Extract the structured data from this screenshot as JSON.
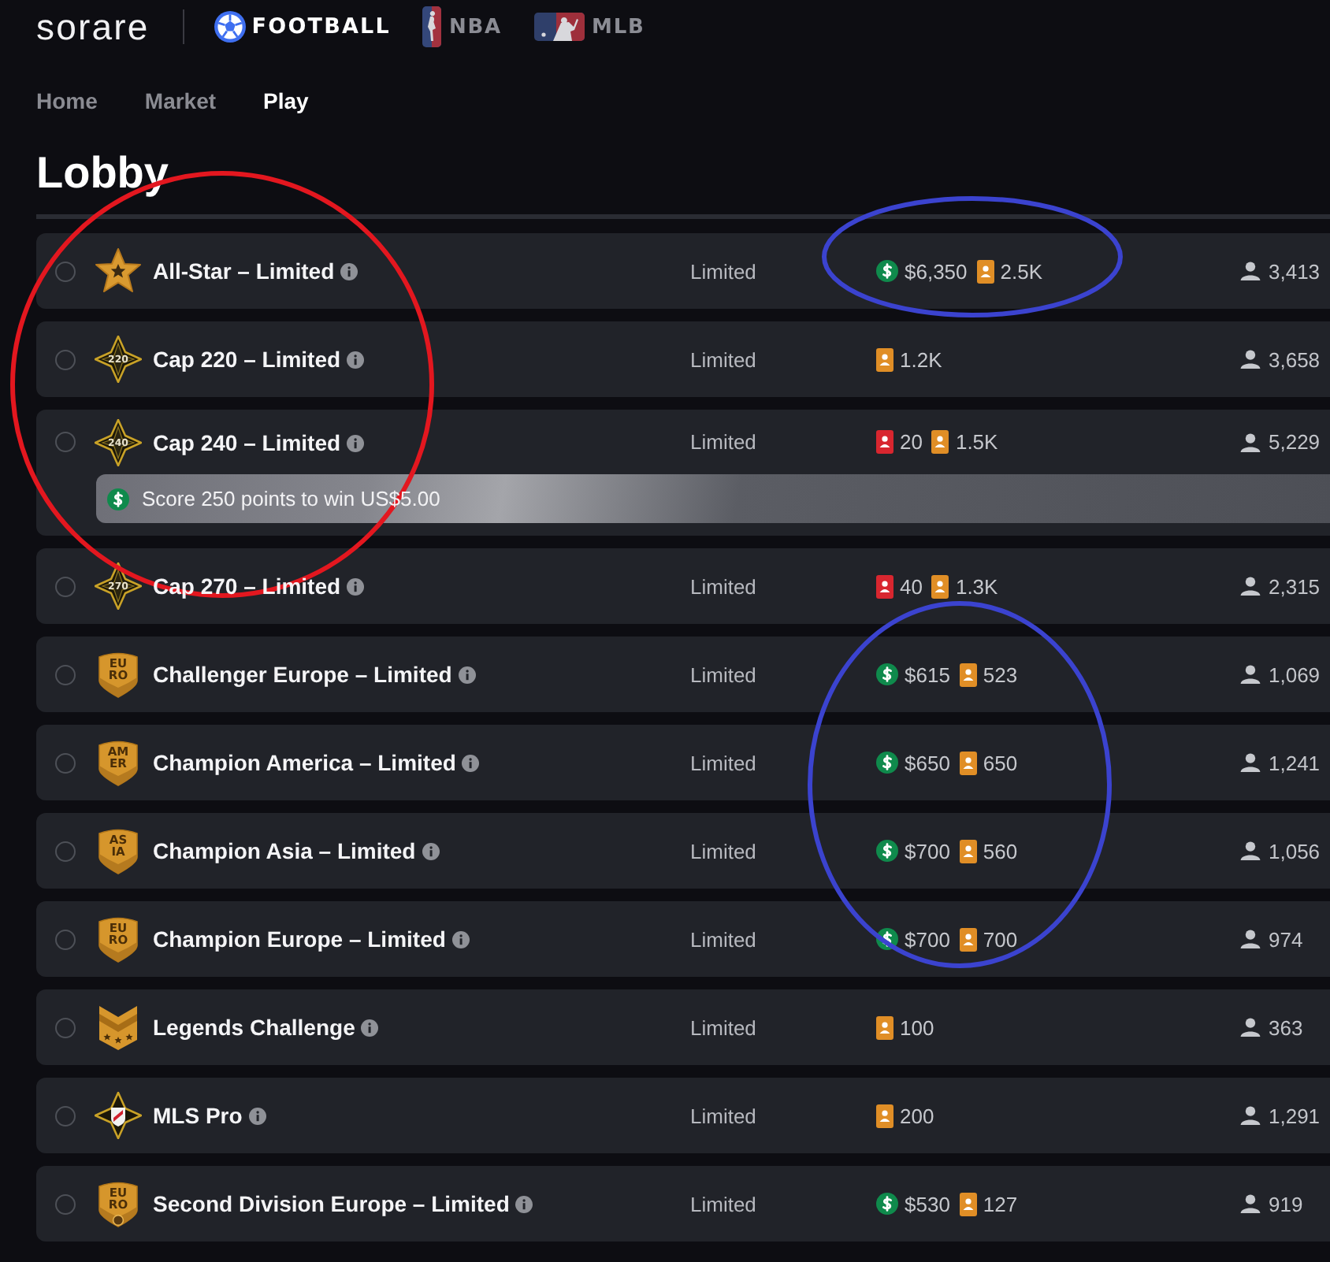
{
  "header": {
    "logo": "sorare",
    "sports": [
      {
        "kind": "football",
        "label": "FOOTBALL",
        "selected": true
      },
      {
        "kind": "nba",
        "label": "NBA",
        "selected": false
      },
      {
        "kind": "mlb",
        "label": "MLB",
        "selected": false
      }
    ]
  },
  "nav": [
    {
      "label": "Home",
      "selected": false
    },
    {
      "label": "Market",
      "selected": false
    },
    {
      "label": "Play",
      "selected": true
    }
  ],
  "title": "Lobby",
  "competitions": [
    {
      "selected": false,
      "emblem": {
        "kind": "star"
      },
      "name": "All-Star – Limited",
      "rarity": "Limited",
      "rewards": [
        {
          "kind": "cash",
          "amount": "$6,350"
        },
        {
          "kind": "limited_card",
          "amount": "2.5K"
        }
      ],
      "participants": "3,413"
    },
    {
      "selected": false,
      "emblem": {
        "kind": "cap",
        "label": "220"
      },
      "name": "Cap 220 – Limited",
      "rarity": "Limited",
      "rewards": [
        {
          "kind": "limited_card",
          "amount": "1.2K"
        }
      ],
      "participants": "3,658"
    },
    {
      "selected": false,
      "emblem": {
        "kind": "cap",
        "label": "240"
      },
      "name": "Cap 240 – Limited",
      "rarity": "Limited",
      "rewards": [
        {
          "kind": "rare_card",
          "amount": "20"
        },
        {
          "kind": "limited_card",
          "amount": "1.5K"
        }
      ],
      "participants": "5,229",
      "banner": {
        "text": "Score 250 points to win US$5.00"
      }
    },
    {
      "selected": false,
      "emblem": {
        "kind": "cap",
        "label": "270"
      },
      "name": "Cap 270 – Limited",
      "rarity": "Limited",
      "rewards": [
        {
          "kind": "rare_card",
          "amount": "40"
        },
        {
          "kind": "limited_card",
          "amount": "1.3K"
        }
      ],
      "participants": "2,315"
    },
    {
      "selected": false,
      "emblem": {
        "kind": "shield",
        "lines": [
          "EU",
          "RO"
        ]
      },
      "name": "Challenger Europe – Limited",
      "rarity": "Limited",
      "rewards": [
        {
          "kind": "cash",
          "amount": "$615"
        },
        {
          "kind": "limited_card",
          "amount": "523"
        }
      ],
      "participants": "1,069"
    },
    {
      "selected": false,
      "emblem": {
        "kind": "shield",
        "lines": [
          "AM",
          "ER"
        ]
      },
      "name": "Champion America – Limited",
      "rarity": "Limited",
      "rewards": [
        {
          "kind": "cash",
          "amount": "$650"
        },
        {
          "kind": "limited_card",
          "amount": "650"
        }
      ],
      "participants": "1,241"
    },
    {
      "selected": false,
      "emblem": {
        "kind": "shield",
        "lines": [
          "AS",
          "IA"
        ]
      },
      "name": "Champion Asia – Limited",
      "rarity": "Limited",
      "rewards": [
        {
          "kind": "cash",
          "amount": "$700"
        },
        {
          "kind": "limited_card",
          "amount": "560"
        }
      ],
      "participants": "1,056"
    },
    {
      "selected": false,
      "emblem": {
        "kind": "shield",
        "lines": [
          "EU",
          "RO"
        ]
      },
      "name": "Champion Europe – Limited",
      "rarity": "Limited",
      "rewards": [
        {
          "kind": "cash",
          "amount": "$700"
        },
        {
          "kind": "limited_card",
          "amount": "700"
        }
      ],
      "participants": "974"
    },
    {
      "selected": false,
      "emblem": {
        "kind": "chevron"
      },
      "name": "Legends Challenge",
      "rarity": "Limited",
      "rewards": [
        {
          "kind": "limited_card",
          "amount": "100"
        }
      ],
      "participants": "363"
    },
    {
      "selected": false,
      "emblem": {
        "kind": "mls"
      },
      "name": "MLS Pro",
      "rarity": "Limited",
      "rewards": [
        {
          "kind": "limited_card",
          "amount": "200"
        }
      ],
      "participants": "1,291"
    },
    {
      "selected": false,
      "emblem": {
        "kind": "shield_division",
        "lines": [
          "EU",
          "RO"
        ]
      },
      "name": "Second Division Europe – Limited",
      "rarity": "Limited",
      "rewards": [
        {
          "kind": "cash",
          "amount": "$530"
        },
        {
          "kind": "limited_card",
          "amount": "127"
        }
      ],
      "participants": "919"
    }
  ],
  "annotations": [
    {
      "kind": "ellipse",
      "color": "#e3171f"
    },
    {
      "kind": "ellipse",
      "color": "#3b43cf"
    },
    {
      "kind": "ellipse",
      "color": "#3b43cf"
    }
  ]
}
